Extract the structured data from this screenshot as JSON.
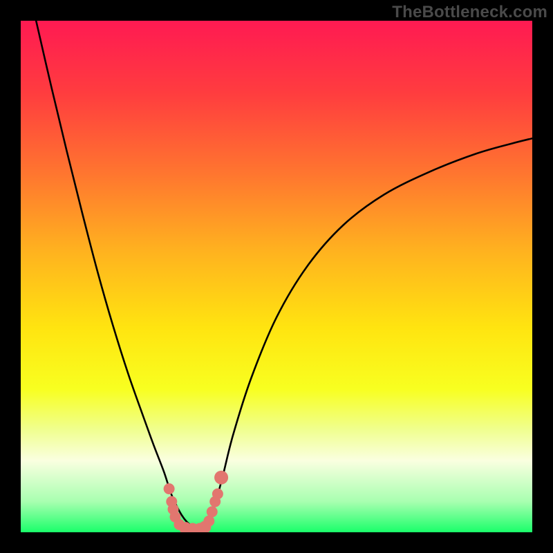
{
  "watermark": "TheBottleneck.com",
  "chart_data": {
    "type": "line",
    "title": "",
    "xlabel": "",
    "ylabel": "",
    "xlim": [
      0,
      1
    ],
    "ylim": [
      0,
      1
    ],
    "gradient_stops": [
      {
        "offset": 0.0,
        "color": "#ff1a52"
      },
      {
        "offset": 0.14,
        "color": "#ff3c3f"
      },
      {
        "offset": 0.3,
        "color": "#ff762f"
      },
      {
        "offset": 0.45,
        "color": "#ffb21f"
      },
      {
        "offset": 0.6,
        "color": "#ffe410"
      },
      {
        "offset": 0.72,
        "color": "#f8ff20"
      },
      {
        "offset": 0.8,
        "color": "#f0ff90"
      },
      {
        "offset": 0.86,
        "color": "#faffe0"
      },
      {
        "offset": 0.94,
        "color": "#a8ffb0"
      },
      {
        "offset": 1.0,
        "color": "#1aff6a"
      }
    ],
    "series": [
      {
        "name": "left-curve",
        "x": [
          0.03,
          0.06,
          0.09,
          0.12,
          0.15,
          0.18,
          0.21,
          0.24,
          0.26,
          0.28,
          0.293,
          0.303,
          0.315,
          0.325,
          0.335,
          0.345
        ],
        "y": [
          1.0,
          0.87,
          0.745,
          0.625,
          0.51,
          0.405,
          0.31,
          0.225,
          0.17,
          0.118,
          0.078,
          0.055,
          0.033,
          0.02,
          0.012,
          0.008
        ]
      },
      {
        "name": "right-curve",
        "x": [
          0.36,
          0.37,
          0.38,
          0.395,
          0.415,
          0.45,
          0.5,
          0.56,
          0.63,
          0.71,
          0.8,
          0.89,
          0.96,
          1.0
        ],
        "y": [
          0.01,
          0.025,
          0.055,
          0.11,
          0.19,
          0.3,
          0.42,
          0.52,
          0.6,
          0.66,
          0.705,
          0.74,
          0.76,
          0.77
        ]
      }
    ],
    "markers": {
      "name": "bottom-markers",
      "color": "#e2766f",
      "points": [
        {
          "x": 0.29,
          "y": 0.085,
          "r": 8
        },
        {
          "x": 0.295,
          "y": 0.06,
          "r": 8
        },
        {
          "x": 0.298,
          "y": 0.045,
          "r": 8
        },
        {
          "x": 0.302,
          "y": 0.03,
          "r": 8
        },
        {
          "x": 0.31,
          "y": 0.015,
          "r": 8
        },
        {
          "x": 0.322,
          "y": 0.008,
          "r": 9
        },
        {
          "x": 0.336,
          "y": 0.006,
          "r": 9
        },
        {
          "x": 0.35,
          "y": 0.006,
          "r": 9
        },
        {
          "x": 0.36,
          "y": 0.01,
          "r": 9
        },
        {
          "x": 0.368,
          "y": 0.022,
          "r": 8
        },
        {
          "x": 0.374,
          "y": 0.04,
          "r": 8
        },
        {
          "x": 0.38,
          "y": 0.06,
          "r": 8
        },
        {
          "x": 0.385,
          "y": 0.075,
          "r": 8
        },
        {
          "x": 0.392,
          "y": 0.107,
          "r": 10
        }
      ]
    }
  }
}
